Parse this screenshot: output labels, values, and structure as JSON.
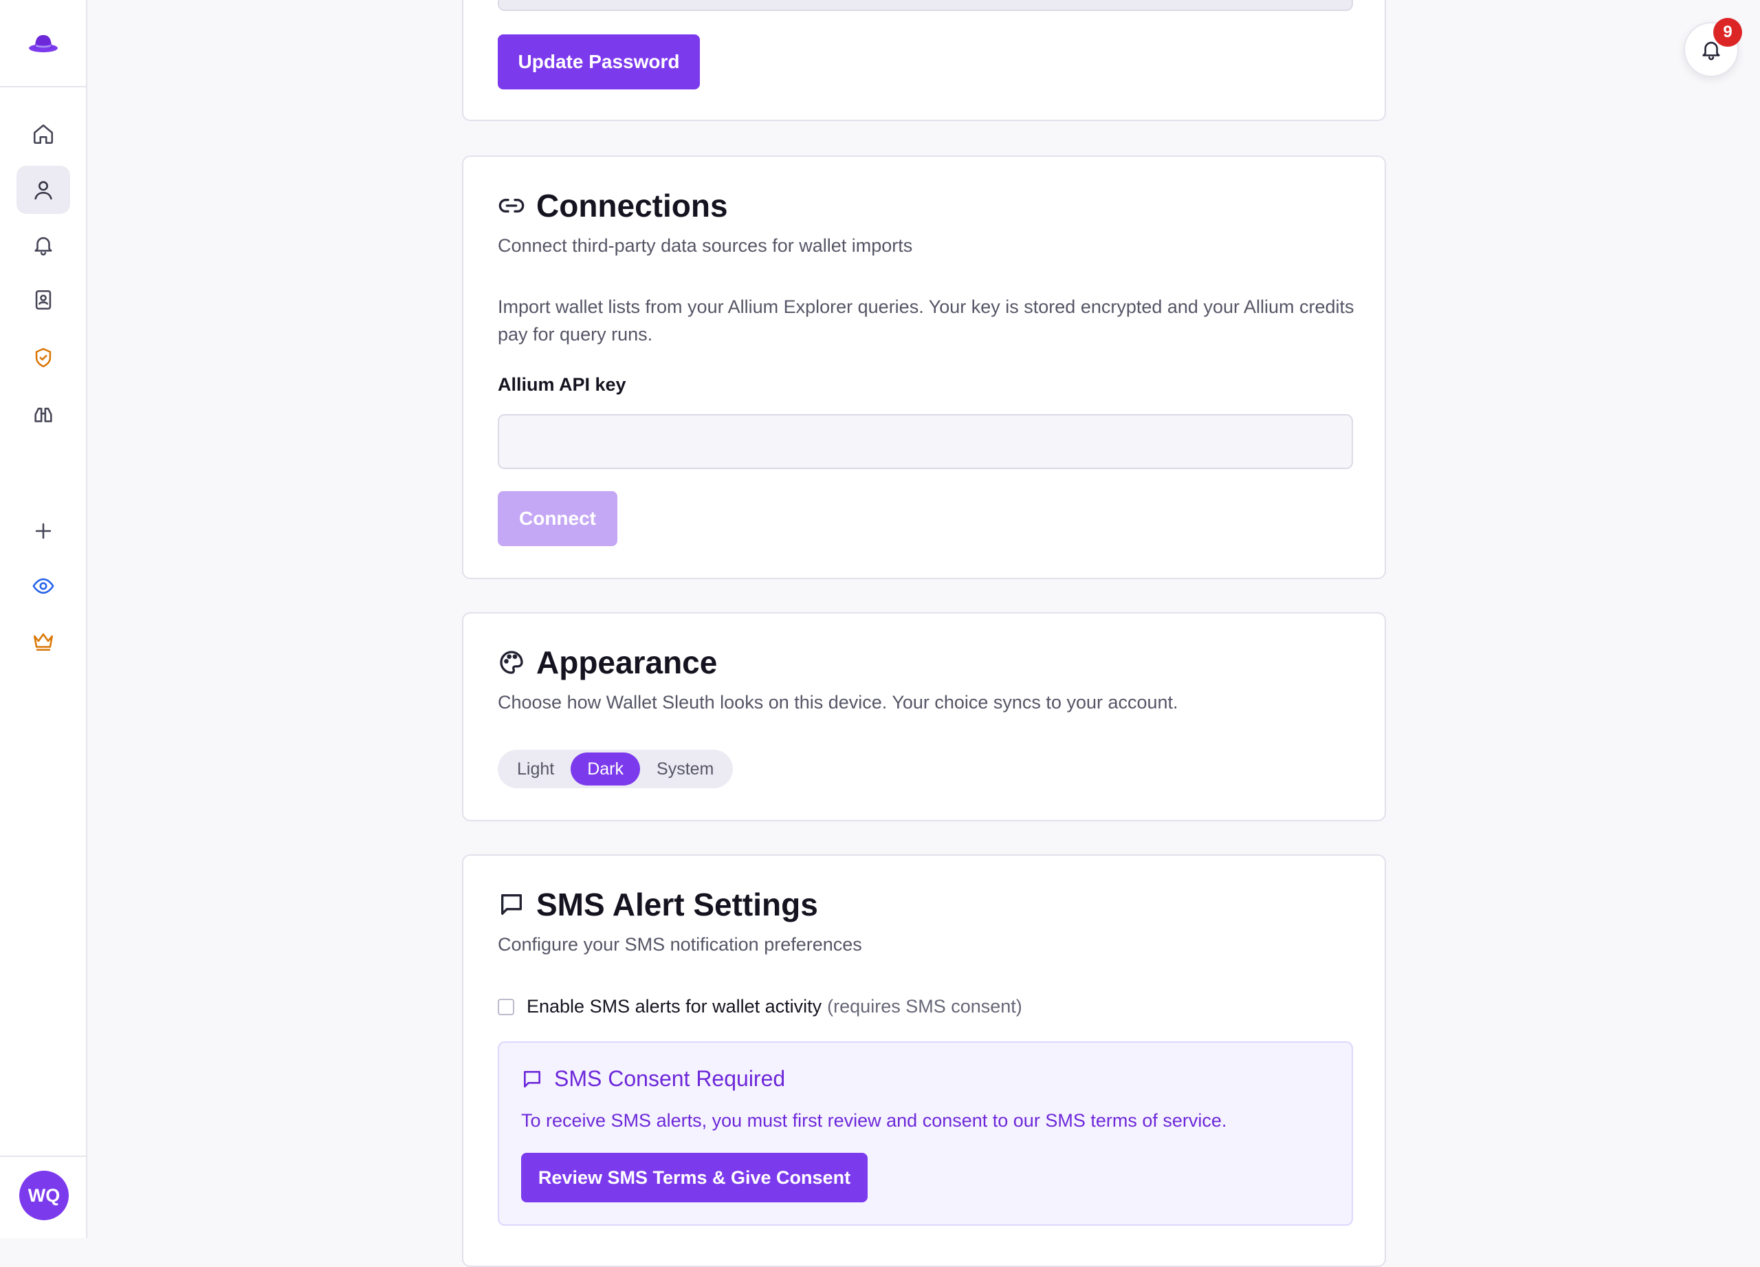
{
  "sidebar": {
    "logo": "hat-logo",
    "items": [
      {
        "icon": "home-icon"
      },
      {
        "icon": "user-icon",
        "active": true
      },
      {
        "icon": "bell-icon"
      },
      {
        "icon": "contact-book-icon"
      },
      {
        "icon": "shield-check-icon",
        "color": "#d97706"
      },
      {
        "icon": "binoculars-icon"
      },
      {
        "icon": "plus-icon"
      },
      {
        "icon": "eye-icon",
        "color": "#2563eb"
      },
      {
        "icon": "crown-icon",
        "color": "#d97706"
      }
    ],
    "avatar_initials": "WQ"
  },
  "notifications": {
    "count": "9"
  },
  "password": {
    "update_label": "Update Password"
  },
  "connections": {
    "title": "Connections",
    "subtitle": "Connect third-party data sources for wallet imports",
    "description": "Import wallet lists from your Allium Explorer queries. Your key is stored encrypted and your Allium credits pay for query runs.",
    "field_label": "Allium API key",
    "field_value": "",
    "connect_label": "Connect"
  },
  "appearance": {
    "title": "Appearance",
    "subtitle": "Choose how Wallet Sleuth looks on this device. Your choice syncs to your account.",
    "options": [
      "Light",
      "Dark",
      "System"
    ],
    "selected": "Dark"
  },
  "sms": {
    "title": "SMS Alert Settings",
    "subtitle": "Configure your SMS notification preferences",
    "checkbox_label": "Enable SMS alerts for wallet activity",
    "checkbox_note": "(requires SMS consent)",
    "consent_title": "SMS Consent Required",
    "consent_text": "To receive SMS alerts, you must first review and consent to our SMS terms of service.",
    "consent_button": "Review SMS Terms & Give Consent"
  },
  "colors": {
    "accent": "#7c3aed",
    "badge": "#dc2626"
  }
}
